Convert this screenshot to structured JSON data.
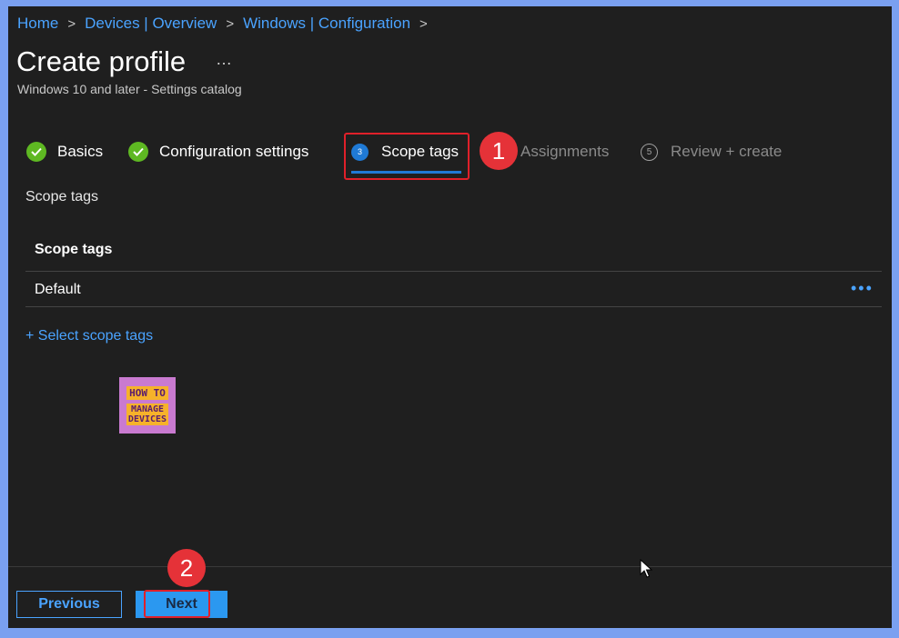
{
  "breadcrumb": [
    "Home",
    "Devices | Overview",
    "Windows | Configuration"
  ],
  "header": {
    "title": "Create profile",
    "more": "…",
    "subtitle": "Windows 10 and later - Settings catalog"
  },
  "steps": [
    {
      "label": "Basics",
      "state": "complete"
    },
    {
      "label": "Configuration settings",
      "state": "complete"
    },
    {
      "label": "Scope tags",
      "number": "3",
      "state": "active"
    },
    {
      "label": "Assignments",
      "state": "pending"
    },
    {
      "label": "Review + create",
      "number": "5",
      "state": "pending"
    }
  ],
  "main": {
    "section_label": "Scope tags",
    "table_header": "Scope tags",
    "rows": [
      {
        "name": "Default",
        "actions": "•••"
      }
    ],
    "select_link": "+ Select scope tags"
  },
  "logo": {
    "line1": "HOW TO",
    "line2": "MANAGE",
    "line3": "DEVICES"
  },
  "footer": {
    "previous": "Previous",
    "next": "Next"
  },
  "annotations": [
    "1",
    "2"
  ],
  "colors": {
    "accent": "#1f7ad6",
    "link": "#4aa3ff",
    "success": "#5eb822",
    "highlight": "#e0202a",
    "badge": "#e53238"
  }
}
